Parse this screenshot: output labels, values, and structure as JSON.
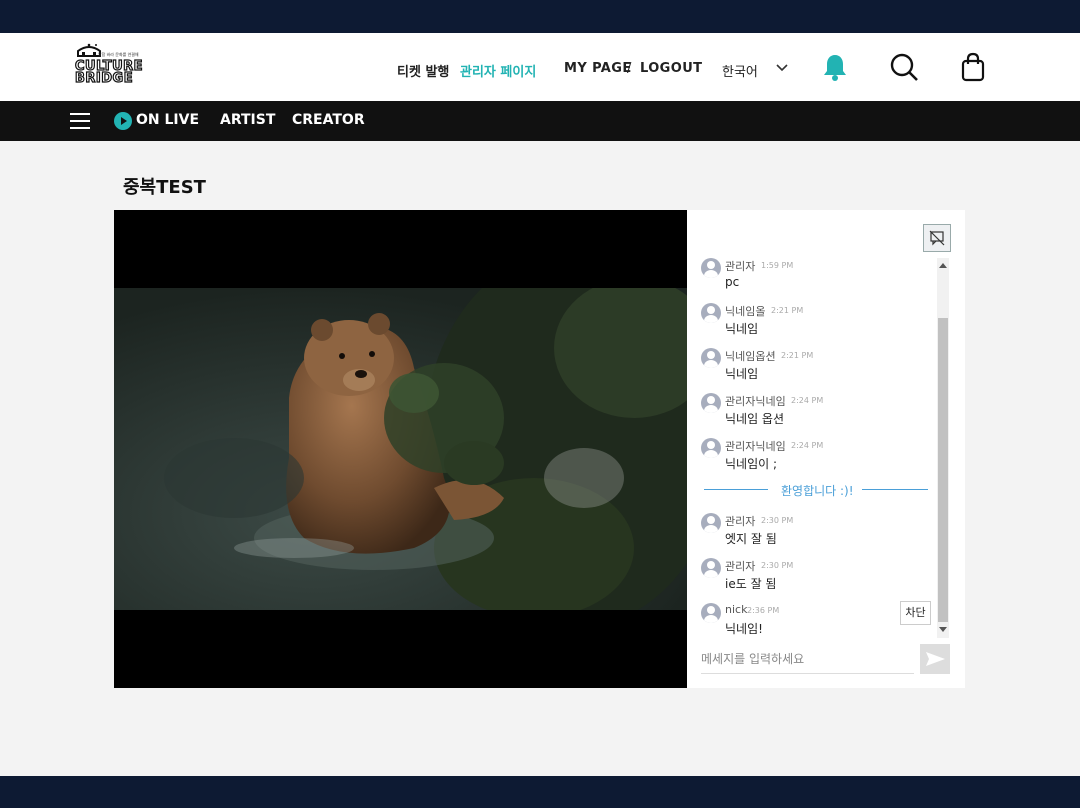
{
  "header": {
    "logo_tagline": "알함 바라 문화를 연결해",
    "logo_line1": "CULTURE",
    "logo_line2": "BRIDGE",
    "nav": {
      "ticket": "티켓 발행",
      "admin": "관리자 페이지",
      "mypage": "MY PAGE",
      "slash": "/",
      "logout": "LOGOUT",
      "language": "한국어"
    }
  },
  "categories": {
    "live": "ON LIVE",
    "artist": "ARTIST",
    "creator": "CREATOR"
  },
  "page": {
    "title": "중복TEST"
  },
  "chat": {
    "messages": [
      {
        "name": "관리자",
        "time": "1:59 PM",
        "text": "pc"
      },
      {
        "name": "닉네임올",
        "time": "2:21 PM",
        "text": "닉네임"
      },
      {
        "name": "닉네임옵션",
        "time": "2:21 PM",
        "text": "닉네임"
      },
      {
        "name": "관리자닉네임",
        "time": "2:24 PM",
        "text": "닉네임 옵션"
      },
      {
        "name": "관리자닉네임",
        "time": "2:24 PM",
        "text": "닉네임이 ;"
      },
      {
        "name": "관리자",
        "time": "2:30 PM",
        "text": "엣지 잘 됨"
      },
      {
        "name": "관리자",
        "time": "2:30 PM",
        "text": "ie도 잘 됨"
      },
      {
        "name": "nick",
        "time": "2:36 PM",
        "text": "닉네임!"
      }
    ],
    "welcome": "환영합니다 :)!",
    "block_label": "차단",
    "input_placeholder": "메세지를 입력하세요"
  },
  "icons": {
    "bell": "bell-icon",
    "search": "search-icon",
    "cart": "shopping-bag-icon",
    "menu": "hamburger-menu-icon",
    "live": "play-circle-icon",
    "chat_toggle": "chat-off-icon",
    "send": "send-icon"
  },
  "colors": {
    "accent": "#22b3b3",
    "topbar": "#0d1a33",
    "catbar": "#111111",
    "welcome": "#4a9fd8"
  }
}
